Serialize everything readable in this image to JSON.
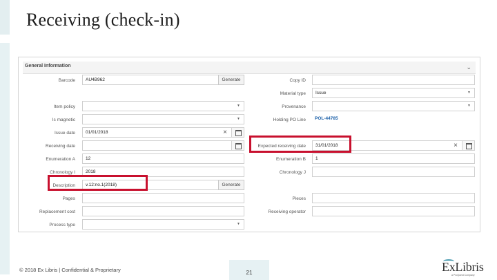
{
  "slide": {
    "title": "Receiving (check-in)",
    "footer": "© 2018 Ex Libris | Confidential & Proprietary",
    "page_number": "21",
    "logo_text": "ExLibris",
    "logo_sub": "a ProQuest Company"
  },
  "panel": {
    "title": "General Information",
    "collapse_icon": "chevron-down-icon"
  },
  "left_fields": [
    {
      "label": "Barcode",
      "value": "AU4B962",
      "button": "Generate"
    },
    {
      "label": "Item policy",
      "value": "",
      "type": "select"
    },
    {
      "label": "Is magnetic",
      "value": "",
      "type": "select"
    },
    {
      "label": "Issue date",
      "value": "01/01/2018",
      "type": "date"
    },
    {
      "label": "Receiving date",
      "value": "",
      "type": "date"
    },
    {
      "label": "Enumeration A",
      "value": "12"
    },
    {
      "label": "Chronology I",
      "value": "2018"
    },
    {
      "label": "Description",
      "value": "v.12:no.1(2018)",
      "button": "Generate"
    },
    {
      "label": "Pages",
      "value": ""
    },
    {
      "label": "Replacement cost",
      "value": ""
    },
    {
      "label": "Process type",
      "value": "",
      "type": "select"
    }
  ],
  "right_fields": [
    {
      "label": "Copy ID",
      "value": ""
    },
    {
      "label": "Material type",
      "value": "Issue",
      "type": "select"
    },
    {
      "label": "Provenance",
      "value": "",
      "type": "select"
    },
    {
      "label": "Holding PO Line",
      "value": "POL-44785",
      "type": "link"
    },
    {
      "label": "Expected receiving date",
      "value": "31/01/2018",
      "type": "date"
    },
    {
      "label": "Enumeration B",
      "value": "1"
    },
    {
      "label": "Chronology J",
      "value": ""
    },
    {
      "label": "Pieces",
      "value": ""
    },
    {
      "label": "Receiving operator",
      "value": ""
    }
  ],
  "colors": {
    "highlight_border": "#c8102e",
    "link": "#1a5fa8",
    "accent_stripe": "#e6f1f3"
  }
}
